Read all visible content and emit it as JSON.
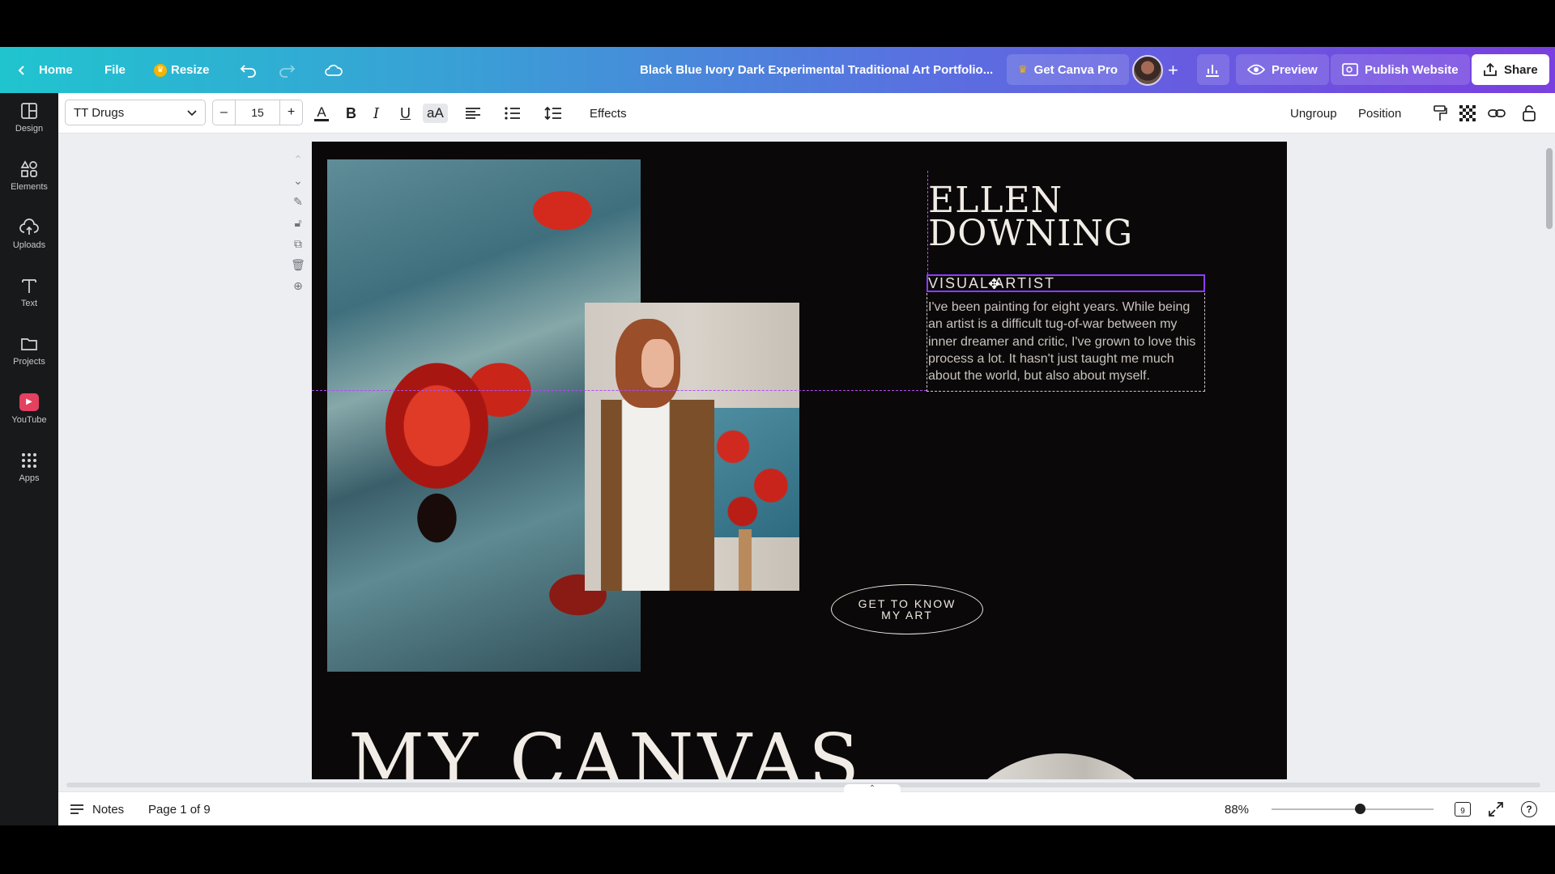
{
  "header": {
    "home": "Home",
    "file": "File",
    "resize": "Resize",
    "title": "Black Blue Ivory Dark Experimental Traditional Art Portfolio...",
    "get_pro": "Get Canva Pro",
    "preview": "Preview",
    "publish": "Publish Website",
    "share": "Share"
  },
  "sidebar": {
    "items": [
      {
        "label": "Design",
        "icon": "layout-icon"
      },
      {
        "label": "Elements",
        "icon": "shapes-icon"
      },
      {
        "label": "Uploads",
        "icon": "cloud-upload-icon"
      },
      {
        "label": "Text",
        "icon": "text-icon"
      },
      {
        "label": "Projects",
        "icon": "folder-icon"
      },
      {
        "label": "YouTube",
        "icon": "youtube-icon"
      },
      {
        "label": "Apps",
        "icon": "apps-grid-icon"
      }
    ]
  },
  "toolbar": {
    "font": "TT Drugs",
    "size": "15",
    "effects": "Effects",
    "ungroup": "Ungroup",
    "position": "Position"
  },
  "design": {
    "name": "ELLEN\nDOWNING",
    "subtitle": "VISUAL ARTIST",
    "bio": "I've been painting for eight years. While being an artist is a difficult tug-of-war between my inner dreamer and critic, I've grown to love this process a lot. It hasn't just taught me much about the world, but also about myself.",
    "cta": "GET TO KNOW\nMY ART",
    "heading": "MY CANVAS"
  },
  "bottom": {
    "notes": "Notes",
    "page": "Page 1 of 9",
    "zoom": "88%",
    "zoom_level": 0.88,
    "pages_badge": "9"
  },
  "colors": {
    "accent": "#8b3dff",
    "page_bg": "#0b0809"
  }
}
